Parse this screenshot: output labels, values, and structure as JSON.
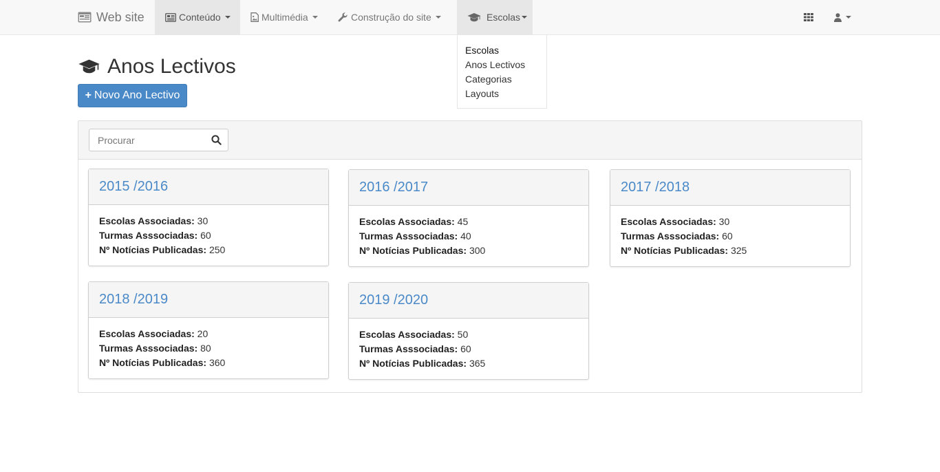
{
  "navbar": {
    "brand": "Web site",
    "items": [
      {
        "label": "Conteúdo",
        "icon": "newspaper-icon"
      },
      {
        "label": "Multimédia",
        "icon": "image-file-icon"
      },
      {
        "label": "Construção do site",
        "icon": "wrench-icon"
      },
      {
        "label": "Escolas",
        "icon": "graduation-cap-icon"
      }
    ],
    "apps_icon": "grid-icon",
    "user_icon": "user-icon"
  },
  "dropdown": {
    "items": [
      "Escolas",
      "Anos Lectivos",
      "Categorias",
      "Layouts"
    ]
  },
  "page": {
    "title": "Anos Lectivos",
    "new_button_plus": "+",
    "new_button_label": "Novo Ano Lectivo"
  },
  "search": {
    "placeholder": "Procurar",
    "value": ""
  },
  "labels": {
    "escolas": "Escolas Associadas:",
    "turmas": "Turmas Asssociadas:",
    "noticias": "Nº Notícias Publicadas:"
  },
  "years": [
    {
      "title": "2015 /2016",
      "escolas": "30",
      "turmas": "60",
      "noticias": "250"
    },
    {
      "title": "2016 /2017",
      "escolas": "45",
      "turmas": "40",
      "noticias": "300"
    },
    {
      "title": "2017 /2018",
      "escolas": "30",
      "turmas": "60",
      "noticias": "325"
    },
    {
      "title": "2018 /2019",
      "escolas": "20",
      "turmas": "80",
      "noticias": "360"
    },
    {
      "title": "2019 /2020",
      "escolas": "50",
      "turmas": "60",
      "noticias": "365"
    }
  ],
  "colors": {
    "accent": "#4a89c8",
    "navbar_bg": "#f8f8f8",
    "navbar_active": "#e7e7e7"
  }
}
